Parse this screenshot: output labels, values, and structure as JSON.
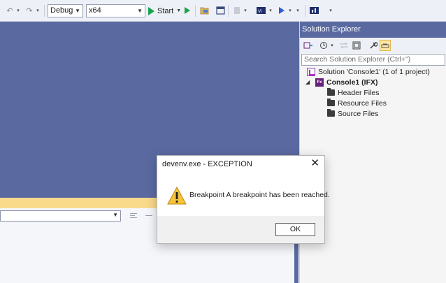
{
  "toolbar": {
    "configuration": "Debug",
    "platform": "x64",
    "start_label": "Start"
  },
  "solution_explorer": {
    "title": "Solution Explorer",
    "search_placeholder": "Search Solution Explorer (Ctrl+\")",
    "solution_label": "Solution 'Console1' (1 of 1 project)",
    "project_label": "Console1 (IFX)",
    "project_icon_text": "Fx",
    "folders": [
      {
        "label": "Header Files"
      },
      {
        "label": "Resource Files"
      },
      {
        "label": "Source Files"
      }
    ]
  },
  "dialog": {
    "title": "devenv.exe - EXCEPTION",
    "message": "Breakpoint A breakpoint has been reached.",
    "ok_label": "OK"
  },
  "colors": {
    "editor_bg": "#5a6aa1",
    "status_band": "#f9d98a",
    "start_green": "#1aa34a",
    "project_purple": "#68217a"
  }
}
